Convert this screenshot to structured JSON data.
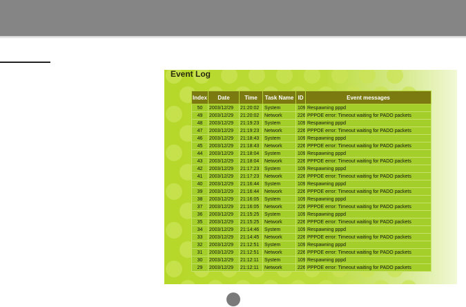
{
  "panel": {
    "title": "Event Log"
  },
  "table": {
    "columns": [
      "Index",
      "Date",
      "Time",
      "Task Name",
      "ID",
      "Event messages"
    ],
    "rows": [
      [
        "50",
        "2003/12/29",
        "21:20:02",
        "System",
        "109",
        "Respawning pppd"
      ],
      [
        "49",
        "2003/12/29",
        "21:20:02",
        "Network",
        "226",
        "PPPOE error: Timeout waiting for PADO packets"
      ],
      [
        "48",
        "2003/12/29",
        "21:19:23",
        "System",
        "109",
        "Respawning pppd"
      ],
      [
        "47",
        "2003/12/29",
        "21:19:23",
        "Network",
        "226",
        "PPPOE error: Timeout waiting for PADO packets"
      ],
      [
        "46",
        "2003/12/29",
        "21:18:43",
        "System",
        "109",
        "Respawning pppd"
      ],
      [
        "45",
        "2003/12/29",
        "21:18:43",
        "Network",
        "226",
        "PPPOE error: Timeout waiting for PADO packets"
      ],
      [
        "44",
        "2003/12/29",
        "21:18:04",
        "System",
        "109",
        "Respawning pppd"
      ],
      [
        "43",
        "2003/12/29",
        "21:18:04",
        "Network",
        "226",
        "PPPOE error: Timeout waiting for PADO packets"
      ],
      [
        "42",
        "2003/12/29",
        "21:17:23",
        "System",
        "109",
        "Respawning pppd"
      ],
      [
        "41",
        "2003/12/29",
        "21:17:23",
        "Network",
        "226",
        "PPPOE error: Timeout waiting for PADO packets"
      ],
      [
        "40",
        "2003/12/29",
        "21:16:44",
        "System",
        "109",
        "Respawning pppd"
      ],
      [
        "39",
        "2003/12/29",
        "21:16:44",
        "Network",
        "226",
        "PPPOE error: Timeout waiting for PADO packets"
      ],
      [
        "38",
        "2003/12/29",
        "21:16:05",
        "System",
        "109",
        "Respawning pppd"
      ],
      [
        "37",
        "2003/12/29",
        "21:16:05",
        "Network",
        "226",
        "PPPOE error: Timeout waiting for PADO packets"
      ],
      [
        "36",
        "2003/12/29",
        "21:15:25",
        "System",
        "109",
        "Respawning pppd"
      ],
      [
        "35",
        "2003/12/29",
        "21:15:25",
        "Network",
        "226",
        "PPPOE error: Timeout waiting for PADO packets"
      ],
      [
        "34",
        "2003/12/29",
        "21:14:46",
        "System",
        "109",
        "Respawning pppd"
      ],
      [
        "33",
        "2003/12/29",
        "21:14:45",
        "Network",
        "226",
        "PPPOE error: Timeout waiting for PADO packets"
      ],
      [
        "32",
        "2003/12/29",
        "21:12:51",
        "System",
        "109",
        "Respawning pppd"
      ],
      [
        "31",
        "2003/12/29",
        "21:12:51",
        "Network",
        "226",
        "PPPOE error: Timeout waiting for PADO packets"
      ],
      [
        "30",
        "2003/12/29",
        "21:12:11",
        "System",
        "109",
        "Respawning pppd"
      ],
      [
        "29",
        "2003/12/29",
        "21:12:11",
        "Network",
        "226",
        "PPPOE error: Timeout waiting for PADO packets"
      ]
    ]
  },
  "colors": {
    "header_bar": "#858585",
    "panel_green": "#b6d829",
    "table_header": "#7a7a10",
    "table_row": "#a4cf2a"
  }
}
